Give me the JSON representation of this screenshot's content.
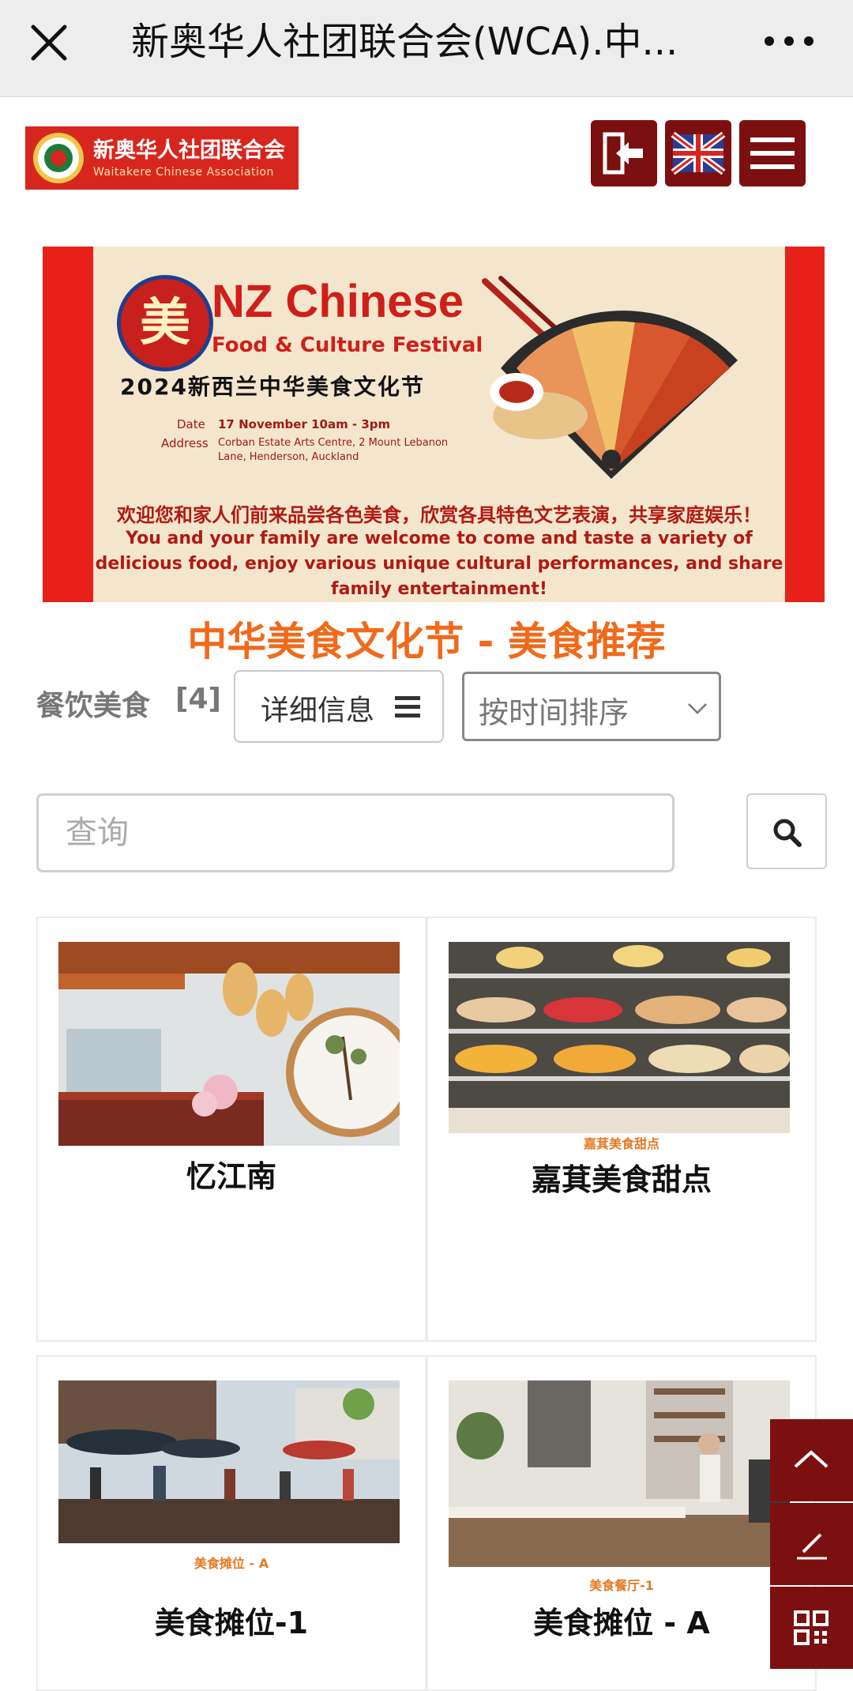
{
  "titlebar": {
    "close_icon": "close-icon",
    "title": "新奥华人社团联合会(WCA).中...",
    "more_icon": "more-dots-icon"
  },
  "header": {
    "logo_cn": "新奥华人社团联合会",
    "logo_en": "Waitakere Chinese Association",
    "login_icon": "login-icon",
    "language_icon": "uk-flag-icon",
    "menu_icon": "hamburger-menu-icon",
    "brand_color": "#7c1010"
  },
  "banner": {
    "badge_char": "美",
    "title_en": "NZ Chinese",
    "subtitle_en": "Food & Culture Festival",
    "title_cn": "2024新西兰中华美食文化节",
    "date_label": "Date",
    "date_value": "17 November 10am - 3pm",
    "address_label": "Address",
    "address_value": "Corban Estate Arts Centre, 2 Mount Lebanon Lane, Henderson, Auckland",
    "message_cn": "欢迎您和家人们前来品尝各色美食，欣赏各具特色文艺表演，共享家庭娱乐！",
    "message_en": "You and your family are welcome to come and taste a variety of delicious food, enjoy various unique cultural performances, and share family entertainment!"
  },
  "section": {
    "title": "中华美食文化节 - 美食推荐",
    "title_color": "#f06a1a",
    "category_label": "餐饮美食",
    "category_count": "[4]",
    "detail_button": "详细信息",
    "sort_selected": "按时间排序"
  },
  "search": {
    "placeholder": "查询",
    "value": ""
  },
  "cards": [
    {
      "image": "restaurant-interior-image",
      "caption": "",
      "name": "忆江南"
    },
    {
      "image": "dessert-display-image",
      "caption": "嘉萁美食甜点",
      "name": "嘉萁美食甜点"
    },
    {
      "image": "street-food-stalls-image",
      "caption": "美食摊位 - A",
      "name": "美食摊位-1"
    },
    {
      "image": "cafe-interior-image",
      "caption": "美食餐厅-1",
      "name": "美食摊位 - A"
    }
  ],
  "side_buttons": {
    "top_icon": "chevron-up-icon",
    "edit_icon": "edit-icon",
    "qr_icon": "qr-code-icon"
  }
}
